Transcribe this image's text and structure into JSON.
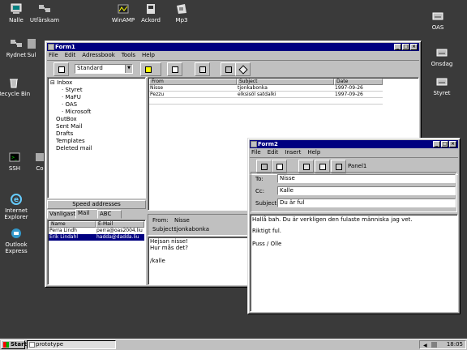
{
  "desktop_icons": [
    {
      "label": "Nalle",
      "icon": "computer-icon"
    },
    {
      "label": "Utfärskam",
      "icon": "network-icon"
    },
    {
      "label": "WinAMP",
      "icon": "winamp-icon"
    },
    {
      "label": "Ackord",
      "icon": "app-icon"
    },
    {
      "label": "Mp3",
      "icon": "folder-icon"
    },
    {
      "label": "OAS",
      "icon": "drive-icon"
    },
    {
      "label": "Rydnet",
      "icon": "network-icon"
    },
    {
      "label": "Sul",
      "icon": "app-icon"
    },
    {
      "label": "Onsdag",
      "icon": "drive-icon"
    },
    {
      "label": "Recycle Bin",
      "icon": "recycle-bin-icon"
    },
    {
      "label": "Styret",
      "icon": "drive-icon"
    },
    {
      "label": "SSH",
      "icon": "terminal-icon"
    },
    {
      "label": "Co",
      "icon": "app-icon"
    },
    {
      "label": "Internet Explorer",
      "icon": "internet-explorer-icon"
    },
    {
      "label": "Outlook Express",
      "icon": "outlook-express-icon"
    }
  ],
  "form1": {
    "title": "Form1",
    "menu": [
      "File",
      "Edit",
      "Adressbook",
      "Tools",
      "Help"
    ],
    "combo_value": "Standard",
    "tree": [
      {
        "label": "Inbox",
        "indent": 0,
        "prefix": "⊟"
      },
      {
        "label": "Styret",
        "indent": 1
      },
      {
        "label": "MaFU",
        "indent": 1
      },
      {
        "label": "OAS",
        "indent": 1
      },
      {
        "label": "Microsoft",
        "indent": 1
      },
      {
        "label": "OutBox",
        "indent": 0
      },
      {
        "label": "Sent Mail",
        "indent": 0
      },
      {
        "label": "Drafts",
        "indent": 0
      },
      {
        "label": "Templates",
        "indent": 0
      },
      {
        "label": "Deleted mail",
        "indent": 0
      }
    ],
    "message_columns": [
      "From",
      "Subject",
      "Date"
    ],
    "messages": [
      {
        "from": "Nisse",
        "subject": "tjonkabonka",
        "date": "1997-09-26"
      },
      {
        "from": "Pezzu",
        "subject": "elksisöl satdalki",
        "date": "1997-09-26"
      }
    ],
    "speed_label": "Speed addresses",
    "speed_tabs": [
      "Vanligast",
      "Mail",
      "ABC"
    ],
    "addr_columns": [
      "Name",
      "E-Mail"
    ],
    "addresses": [
      {
        "name": "Perra Lindh",
        "email": "perra@oas2004.liu"
      },
      {
        "name": "Erik Lindahl",
        "email": "hadda@dadda.liu"
      }
    ],
    "preview": {
      "from_label": "From:",
      "from": "Nisse",
      "subject_label": "Subject:",
      "subject": "tjonkabonka",
      "body": [
        "Hejsan nisse!",
        "Hur mås det?",
        "",
        "/kalle"
      ]
    }
  },
  "form2": {
    "title": "Form2",
    "menu": [
      "File",
      "Edit",
      "Insert",
      "Help"
    ],
    "panel_label": "Panel1",
    "to_label": "To:",
    "to": "Nisse",
    "cc_label": "Cc:",
    "cc": "Kalle",
    "subject_label": "Subject:",
    "subject": "Du är ful",
    "body": [
      "Hallå bah. Du är verkligen den fulaste människa jag vet.",
      "",
      "Riktigt ful.",
      "",
      "Puss / Olle"
    ]
  },
  "taskbar": {
    "start": "Start",
    "task": "prototype",
    "clock": "18:05"
  },
  "colors": {
    "titlebar": "#000080",
    "selection": "#000080",
    "desktop": "#3a3a3a",
    "face": "#c0c0c0"
  }
}
